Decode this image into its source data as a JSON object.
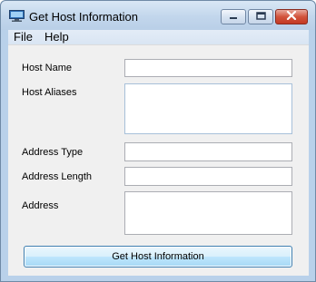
{
  "window": {
    "title": "Get Host Information"
  },
  "menu": {
    "items": [
      "File",
      "Help"
    ]
  },
  "form": {
    "fields": [
      {
        "label": "Host Name",
        "value": ""
      },
      {
        "label": "Host Aliases",
        "value": ""
      },
      {
        "label": "Address Type",
        "value": ""
      },
      {
        "label": "Address Length",
        "value": ""
      },
      {
        "label": "Address",
        "value": ""
      }
    ]
  },
  "actions": {
    "get_info_label": "Get Host Information"
  },
  "icons": {
    "app": "monitor-icon",
    "minimize": "minimize-icon",
    "maximize": "maximize-icon",
    "close": "close-icon"
  },
  "colors": {
    "title_bar": "#c2d6ec",
    "client_bg": "#f0f0f0",
    "close_button": "#c43a23",
    "primary_button_border": "#3c7fb1"
  }
}
